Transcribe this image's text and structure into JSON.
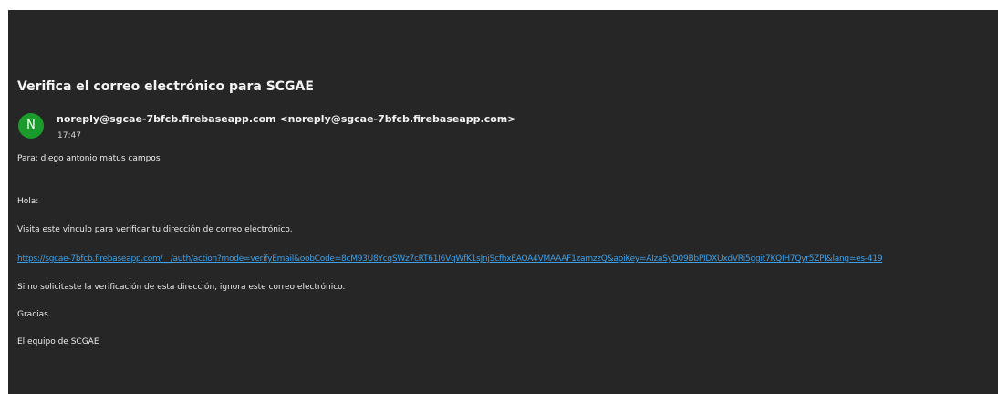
{
  "email": {
    "subject": "Verifica el correo electrónico para SCGAE",
    "avatar_letter": "N",
    "sender": "noreply@sgcae-7bfcb.firebaseapp.com <noreply@sgcae-7bfcb.firebaseapp.com>",
    "time": "17:47",
    "to": "Para: diego antonio matus campos",
    "body": {
      "greeting": "Hola:",
      "instruction": "Visita este vínculo para verificar tu dirección de correo electrónico.",
      "link": "https://sgcae-7bfcb.firebaseapp.com/__/auth/action?mode=verifyEmail&oobCode=8cM93U8YcqSWz7cRT61I6VqWfK1sJnjScfhxEAOA4VMAAAF1zamzzQ&apiKey=AIzaSyD09BbPIDXUxdVRi5ggit7KQIH7Qyr5ZPI&lang=es-419",
      "disclaimer": "Si no solicitaste la verificación de esta dirección, ignora este correo electrónico.",
      "thanks": "Gracias.",
      "signature": "El equipo de SCGAE"
    }
  },
  "colors": {
    "background": "#262626",
    "avatar": "#1a9b2c",
    "link": "#3f9fe6"
  }
}
